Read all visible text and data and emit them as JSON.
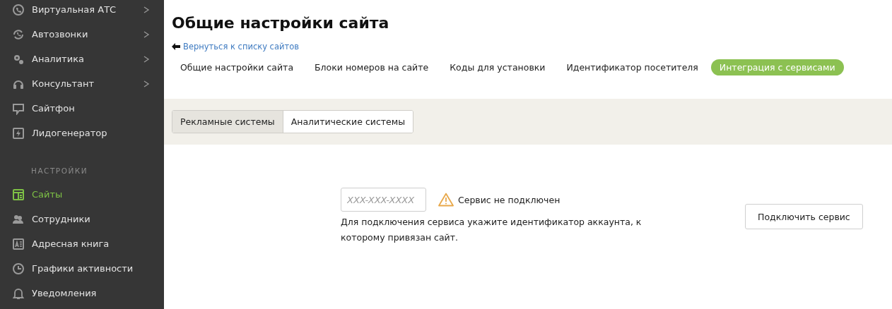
{
  "sidebar": {
    "items": [
      {
        "label": "Виртуальная АТС",
        "submenu": true,
        "selected": false
      },
      {
        "label": "Автозвонки",
        "submenu": true,
        "selected": false
      },
      {
        "label": "Аналитика",
        "submenu": true,
        "selected": false
      },
      {
        "label": "Консультант",
        "submenu": true,
        "selected": false
      },
      {
        "label": "Сайтфон",
        "submenu": false,
        "selected": false
      },
      {
        "label": "Лидогенератор",
        "submenu": false,
        "selected": false
      }
    ],
    "section": {
      "title": "НАСТРОЙКИ",
      "items": [
        {
          "label": "Сайты",
          "submenu": false,
          "selected": true
        },
        {
          "label": "Сотрудники",
          "submenu": false,
          "selected": false
        },
        {
          "label": "Адресная книга",
          "submenu": false,
          "selected": false
        },
        {
          "label": "Графики активности",
          "submenu": false,
          "selected": false
        },
        {
          "label": "Уведомления",
          "submenu": false,
          "selected": false
        }
      ]
    }
  },
  "page": {
    "title": "Общие настройки сайта",
    "back_link": "Вернуться к списку сайтов"
  },
  "tabs": [
    {
      "label": "Общие настройки сайта",
      "selected": false
    },
    {
      "label": "Блоки номеров на сайте",
      "selected": false
    },
    {
      "label": "Коды для установки",
      "selected": false
    },
    {
      "label": "Идентификатор посетителя",
      "selected": false
    },
    {
      "label": "Интеграция с сервисами",
      "selected": true
    }
  ],
  "subtabs": [
    {
      "label": "Рекламные системы",
      "selected": true
    },
    {
      "label": "Аналитические системы",
      "selected": false
    }
  ],
  "service": {
    "placeholder": "XXX-XXX-XXXX",
    "status": "Сервис не подключен",
    "hint": "Для подключения сервиса укажите идентификатор аккаунта, к которому привязан сайт.",
    "button": "Подключить сервис"
  }
}
